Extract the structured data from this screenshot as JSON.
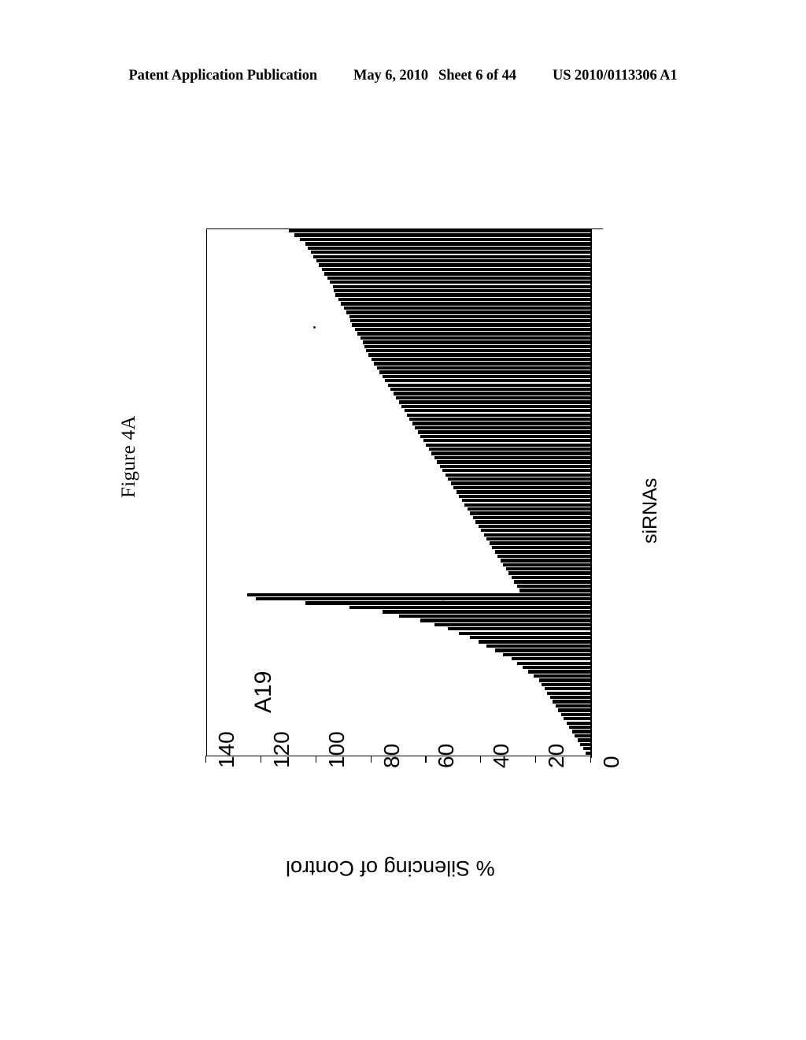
{
  "header": {
    "publication": "Patent Application Publication",
    "date": "May 6, 2010",
    "sheet": "Sheet 6 of 44",
    "patent_number": "US 2010/0113306 A1"
  },
  "figure": {
    "caption": "Figure 4A",
    "annotation": "A19"
  },
  "chart_data": {
    "type": "bar",
    "title": "Figure 4A",
    "orientation": "vertical-rotated-90ccw",
    "xlabel": "siRNAs",
    "ylabel": "% Silencing of Control",
    "ylim": [
      0,
      140
    ],
    "yticks": [
      140,
      120,
      100,
      80,
      60,
      40,
      20,
      0
    ],
    "ytick_labels": [
      "140",
      "120",
      "100",
      "80",
      "60",
      "40",
      "20",
      "0"
    ],
    "grid": false,
    "legend": null,
    "bar_color": "#000000",
    "annotations": [
      {
        "label": "A19",
        "value": 125,
        "note": "outlier spike above sorted series"
      }
    ],
    "categories_note": "individual siRNAs, unlabeled, sorted by descending silencing",
    "values": [
      110,
      108,
      106,
      104,
      103,
      102,
      101,
      100,
      99,
      98,
      97,
      96,
      95,
      94,
      93.5,
      93,
      92,
      91,
      90,
      89,
      88,
      87.5,
      87,
      86,
      85,
      84,
      83,
      82.5,
      82,
      81,
      80,
      79,
      78,
      77,
      76,
      75,
      74,
      73,
      72,
      71,
      70,
      69,
      68,
      67,
      66,
      65,
      64,
      63,
      62,
      61,
      60,
      59,
      58,
      57,
      56,
      55,
      54,
      53,
      52,
      51,
      50,
      49,
      48,
      47,
      46,
      45,
      44,
      43,
      42,
      41,
      40,
      39,
      38,
      37,
      36,
      35,
      34,
      33,
      32,
      31,
      30,
      29,
      28,
      27,
      26,
      125,
      122,
      104,
      88,
      76,
      70,
      62,
      57,
      52,
      48,
      44,
      41,
      38,
      35,
      32,
      29,
      27,
      25,
      23,
      21,
      19,
      18,
      17,
      16,
      15,
      14,
      13,
      12,
      11,
      10,
      9,
      8,
      7,
      6,
      5,
      4,
      3,
      2
    ]
  }
}
